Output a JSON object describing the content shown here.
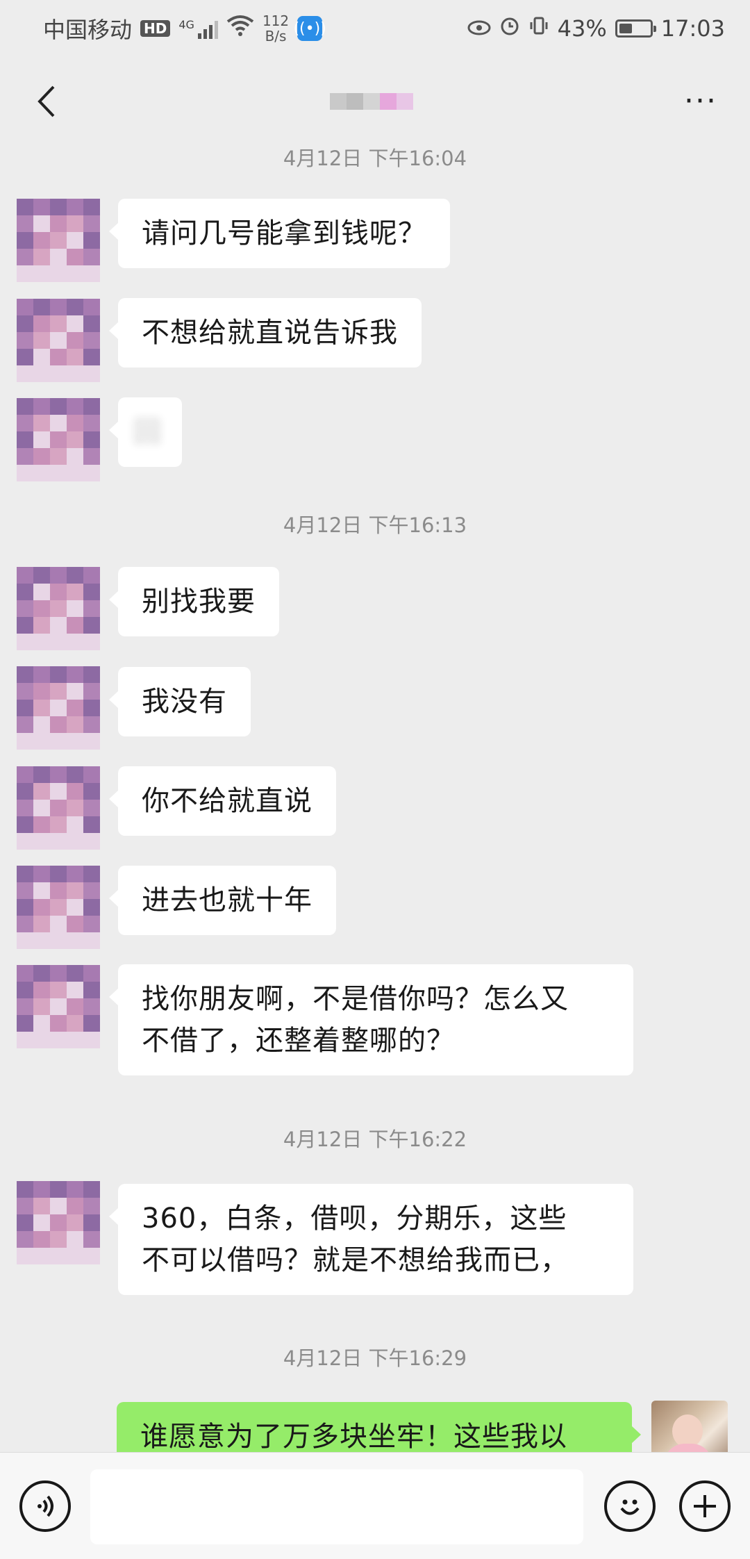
{
  "status_bar": {
    "carrier": "中国移动",
    "hd": "HD",
    "network": "4G",
    "speed_value": "112",
    "speed_unit": "B/s",
    "battery": "43%",
    "battery_level": 0.43,
    "time": "17:03"
  },
  "nav": {
    "more": "···"
  },
  "messages": [
    {
      "type": "time",
      "text": "4月12日 下午16:04"
    },
    {
      "type": "in",
      "text": "请问几号能拿到钱呢？"
    },
    {
      "type": "in",
      "text": "不想给就直说告诉我"
    },
    {
      "type": "in",
      "text": "回"
    },
    {
      "type": "time",
      "text": "4月12日 下午16:13"
    },
    {
      "type": "in",
      "text": "别找我要"
    },
    {
      "type": "in",
      "text": "我没有"
    },
    {
      "type": "in",
      "text": "你不给就直说"
    },
    {
      "type": "in",
      "text": "进去也就十年"
    },
    {
      "type": "in",
      "lines": [
        "找你朋友啊，不是借你吗？怎么又",
        "不借了，还整着整哪的？"
      ]
    },
    {
      "type": "time",
      "text": "4月12日 下午16:22"
    },
    {
      "type": "in",
      "lines": [
        "360，白条，借呗，分期乐，这些",
        "不可以借吗？就是不想给我而已，"
      ]
    },
    {
      "type": "time",
      "text": "4月12日 下午16:29"
    },
    {
      "type": "out",
      "text": "谁愿意为了万多块坐牢！这些我以"
    }
  ],
  "input": {
    "value": ""
  },
  "colors": {
    "background": "#ededed",
    "incoming_bubble": "#ffffff",
    "outgoing_bubble": "#95ec69",
    "avatar_palette": [
      "#8d6aa3",
      "#a77ab1",
      "#c890b8",
      "#d7a5c2",
      "#e8d6e6",
      "#b184b6"
    ]
  },
  "icons": {
    "back": "chevron-left-icon",
    "more": "more-icon",
    "voice": "voice-icon",
    "emoji": "emoji-icon",
    "plus": "plus-icon"
  }
}
